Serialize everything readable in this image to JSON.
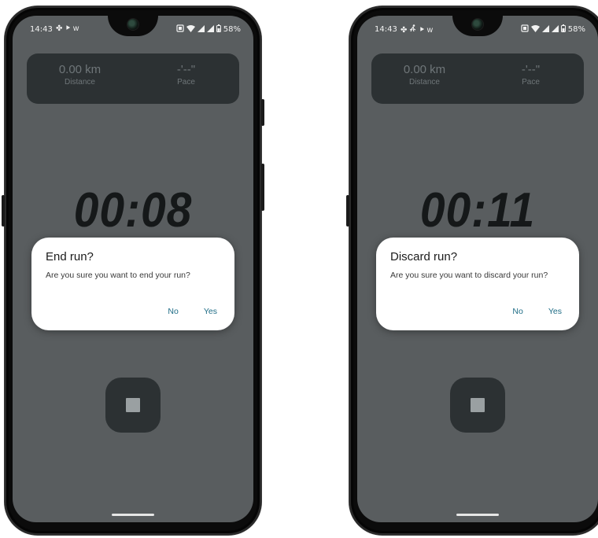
{
  "screens": [
    {
      "status": {
        "time": "14:43",
        "left_icons": [
          "✤",
          "⯈",
          "ᴡ"
        ],
        "battery": "58%"
      },
      "stats": {
        "distance_value": "0.00 km",
        "distance_label": "Distance",
        "pace_value": "-'--\"",
        "pace_label": "Pace"
      },
      "timer": "00:08",
      "dialog": {
        "title": "End run?",
        "message": "Are you sure you want to end your run?",
        "no_label": "No",
        "yes_label": "Yes"
      }
    },
    {
      "status": {
        "time": "14:43",
        "left_icons": [
          "✤",
          "🏃",
          "⯈",
          "ᴡ"
        ],
        "battery": "58%"
      },
      "stats": {
        "distance_value": "0.00 km",
        "distance_label": "Distance",
        "pace_value": "-'--\"",
        "pace_label": "Pace"
      },
      "timer": "00:11",
      "dialog": {
        "title": "Discard run?",
        "message": "Are you sure you want to discard your run?",
        "no_label": "No",
        "yes_label": "Yes"
      }
    }
  ],
  "colors": {
    "screen_bg": "#595d5f",
    "card_bg": "#2c3133",
    "dialog_button": "#1f6d86"
  }
}
